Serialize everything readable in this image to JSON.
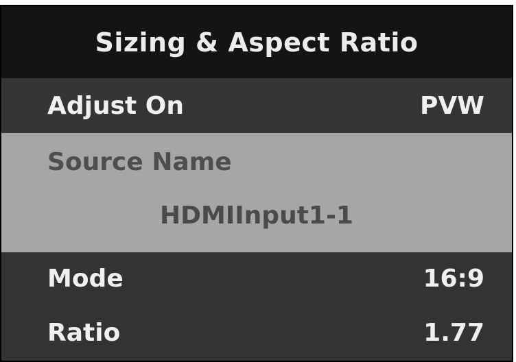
{
  "header": {
    "title": "Sizing & Aspect Ratio"
  },
  "rows": {
    "adjust_on": {
      "label": "Adjust On",
      "value": "PVW"
    },
    "source": {
      "label": "Source Name",
      "value": "HDMIInput1-1"
    },
    "mode": {
      "label": "Mode",
      "value": "16:9"
    },
    "ratio": {
      "label": "Ratio",
      "value": "1.77"
    }
  },
  "colors": {
    "title_background": "#141414",
    "row_background": "#353535",
    "selected_row_background": "#a6a6a6",
    "selected_text": "#4e4e4e",
    "text": "#f0f0f0"
  }
}
